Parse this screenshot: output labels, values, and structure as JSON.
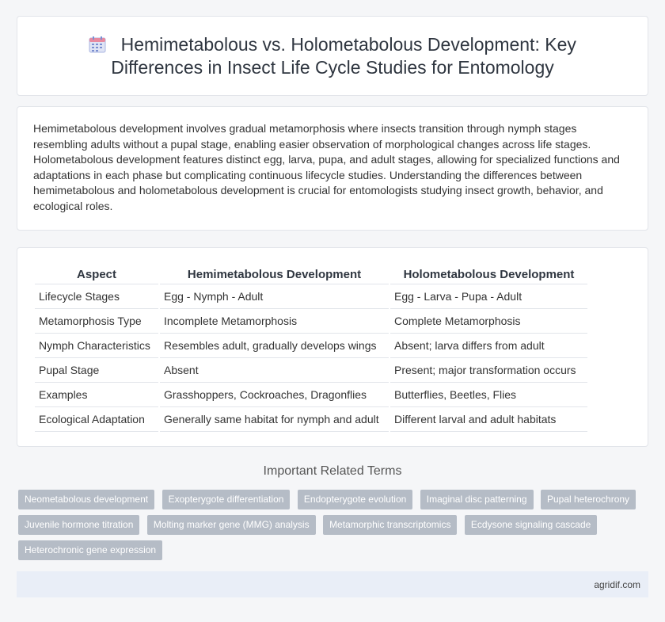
{
  "title": "Hemimetabolous vs. Holometabolous Development: Key Differences in Insect Life Cycle Studies for Entomology",
  "icon": "calendar-icon",
  "intro": "Hemimetabolous development involves gradual metamorphosis where insects transition through nymph stages resembling adults without a pupal stage, enabling easier observation of morphological changes across life stages. Holometabolous development features distinct egg, larva, pupa, and adult stages, allowing for specialized functions and adaptations in each phase but complicating continuous lifecycle studies. Understanding the differences between hemimetabolous and holometabolous development is crucial for entomologists studying insect growth, behavior, and ecological roles.",
  "table": {
    "headers": [
      "Aspect",
      "Hemimetabolous Development",
      "Holometabolous Development"
    ],
    "rows": [
      [
        "Lifecycle Stages",
        "Egg - Nymph - Adult",
        "Egg - Larva - Pupa - Adult"
      ],
      [
        "Metamorphosis Type",
        "Incomplete Metamorphosis",
        "Complete Metamorphosis"
      ],
      [
        "Nymph Characteristics",
        "Resembles adult, gradually develops wings",
        "Absent; larva differs from adult"
      ],
      [
        "Pupal Stage",
        "Absent",
        "Present; major transformation occurs"
      ],
      [
        "Examples",
        "Grasshoppers, Cockroaches, Dragonflies",
        "Butterflies, Beetles, Flies"
      ],
      [
        "Ecological Adaptation",
        "Generally same habitat for nymph and adult",
        "Different larval and adult habitats"
      ]
    ]
  },
  "related": {
    "heading": "Important Related Terms",
    "tags": [
      "Neometabolous development",
      "Exopterygote differentiation",
      "Endopterygote evolution",
      "Imaginal disc patterning",
      "Pupal heterochrony",
      "Juvenile hormone titration",
      "Molting marker gene (MMG) analysis",
      "Metamorphic transcriptomics",
      "Ecdysone signaling cascade",
      "Heterochronic gene expression"
    ]
  },
  "footer": "agridif.com",
  "colors": {
    "accent": "#7b8fd1",
    "tag_bg": "#b5bcc6",
    "footer_bg": "#e9eef7"
  }
}
